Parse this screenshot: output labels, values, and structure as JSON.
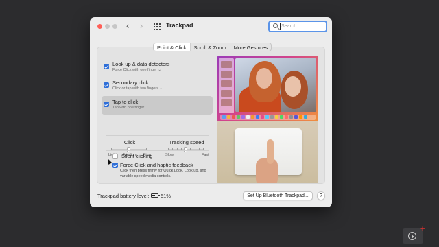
{
  "window": {
    "title": "Trackpad"
  },
  "search": {
    "placeholder": "Search",
    "value": ""
  },
  "tabs": [
    {
      "label": "Point & Click",
      "active": true
    },
    {
      "label": "Scroll & Zoom",
      "active": false
    },
    {
      "label": "More Gestures",
      "active": false
    }
  ],
  "options": [
    {
      "label": "Look up & data detectors",
      "sub": "Force Click with one finger ⌄",
      "checked": true
    },
    {
      "label": "Secondary click",
      "sub": "Click or tap with two fingers ⌄",
      "checked": true
    },
    {
      "label": "Tap to click",
      "sub": "Tap with one finger",
      "checked": true,
      "selected": true
    }
  ],
  "click_slider": {
    "label": "Click",
    "ends": [
      "Light",
      "Medium",
      "Firm"
    ],
    "value": 0.5
  },
  "speed_slider": {
    "label": "Tracking speed",
    "ends": [
      "Slow",
      "Fast"
    ],
    "value": 0.5
  },
  "silent": {
    "label": "Silent clicking",
    "checked": false
  },
  "force": {
    "label": "Force Click and haptic feedback",
    "desc": "Click then press firmly for Quick Look, Look up, and variable speed media controls.",
    "checked": true
  },
  "battery": {
    "label": "Trackpad battery level:",
    "value": "51%",
    "level": 0.51
  },
  "buttons": {
    "bluetooth": "Set Up Bluetooth Trackpad...",
    "help": "?"
  },
  "icons": {
    "back": "chevron-left-icon",
    "forward": "chevron-right-icon",
    "grid": "grid-icon",
    "search": "search-icon",
    "battery": "battery-icon",
    "play": "play-icon"
  },
  "colors": {
    "accent": "#2f6fd8",
    "close": "#ff5f57"
  }
}
